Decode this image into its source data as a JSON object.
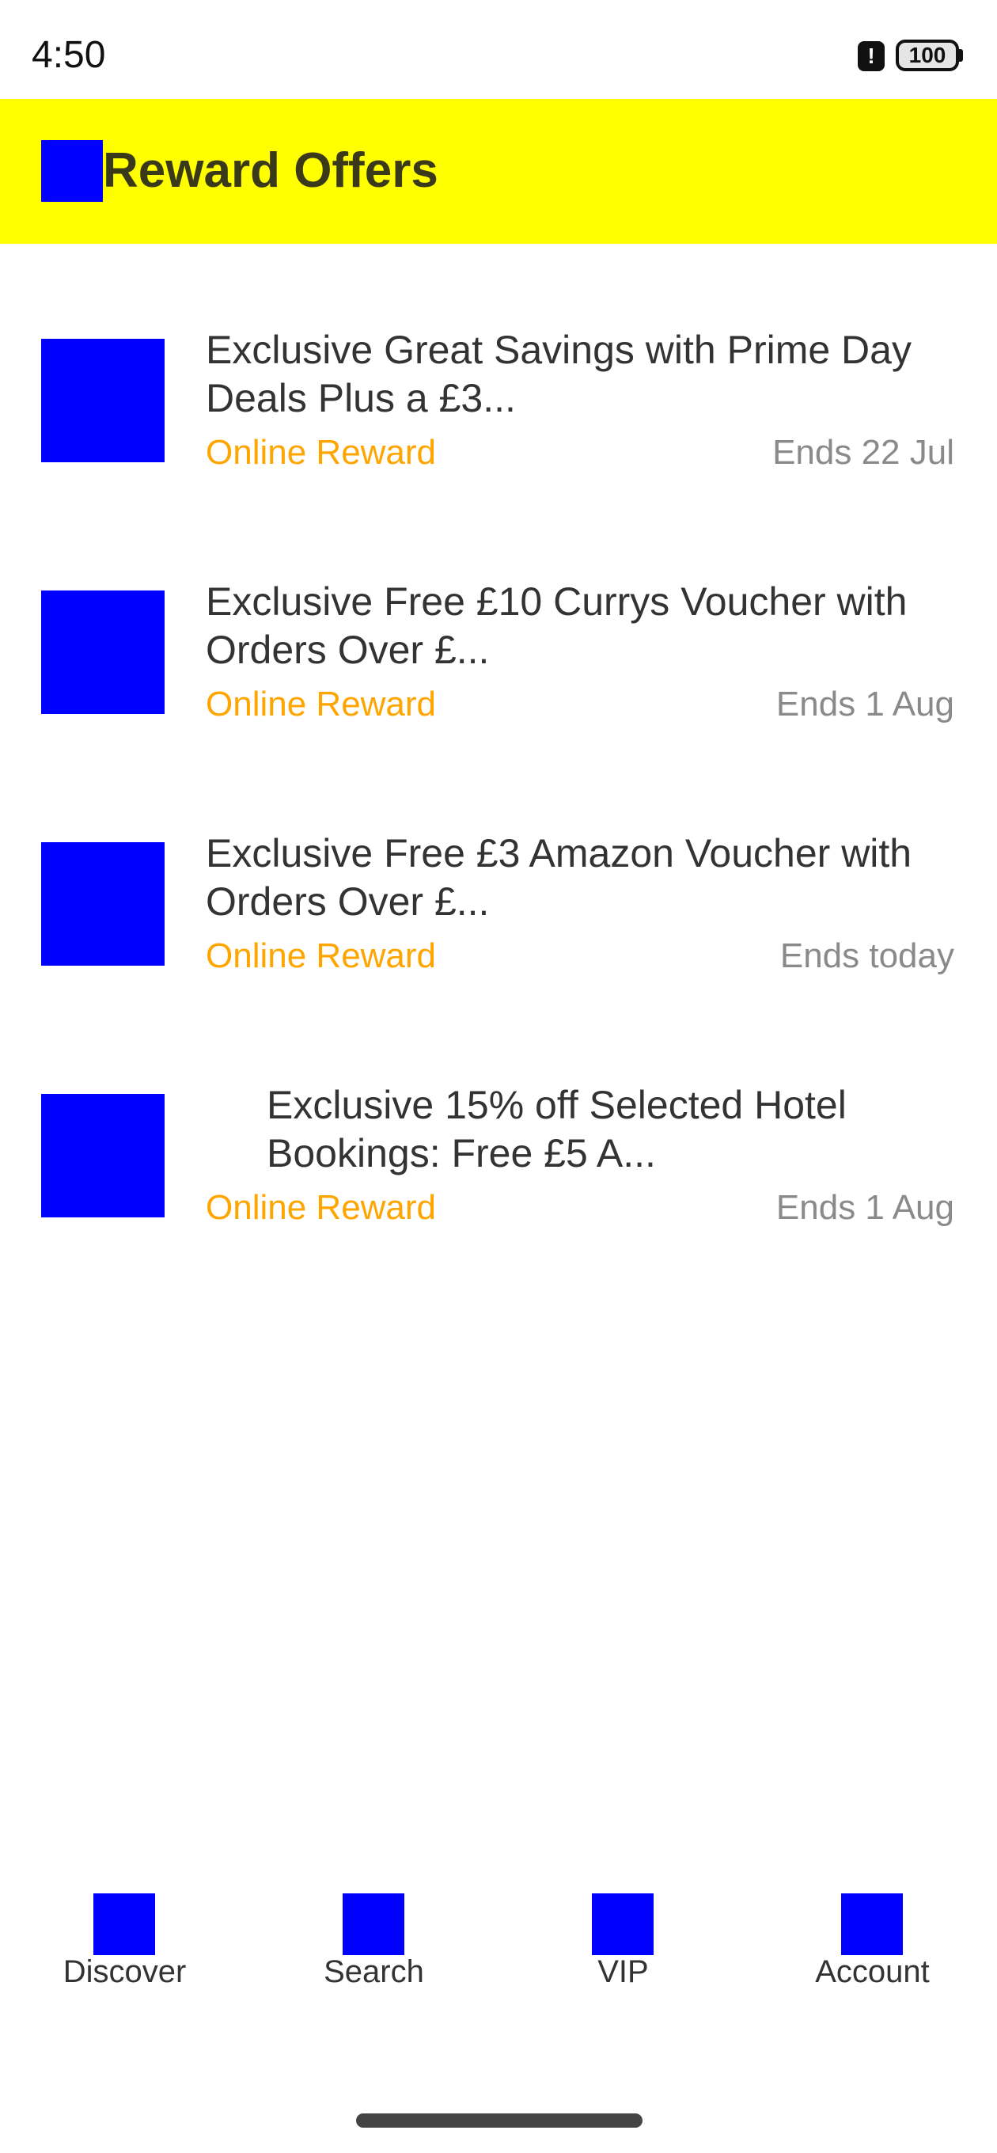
{
  "status_bar": {
    "time": "4:50",
    "battery_level": "100",
    "alert_icon": "alert-icon"
  },
  "header": {
    "title": "Reward Offers",
    "icon": "app-logo-icon",
    "background_color": "#ffff00"
  },
  "offers": [
    {
      "title": "Exclusive Great Savings with Prime Day Deals Plus a £3...",
      "type": "Online Reward",
      "ends": "Ends 22 Jul"
    },
    {
      "title": "Exclusive Free £10 Currys Voucher with Orders Over £...",
      "type": "Online Reward",
      "ends": "Ends 1 Aug"
    },
    {
      "title": "Exclusive Free £3 Amazon Voucher with Orders Over £...",
      "type": "Online Reward",
      "ends": "Ends today"
    },
    {
      "title": "Exclusive 15% off Selected Hotel Bookings: Free £5 A...",
      "type": "Online Reward",
      "ends": "Ends 1 Aug"
    }
  ],
  "bottom_nav": {
    "items": [
      {
        "label": "Discover",
        "icon": "discover-icon"
      },
      {
        "label": "Search",
        "icon": "search-icon"
      },
      {
        "label": "VIP",
        "icon": "vip-icon"
      },
      {
        "label": "Account",
        "icon": "account-icon"
      }
    ]
  },
  "colors": {
    "accent": "#ffa500",
    "placeholder": "#0000ff",
    "muted_text": "#8a8a8a"
  }
}
